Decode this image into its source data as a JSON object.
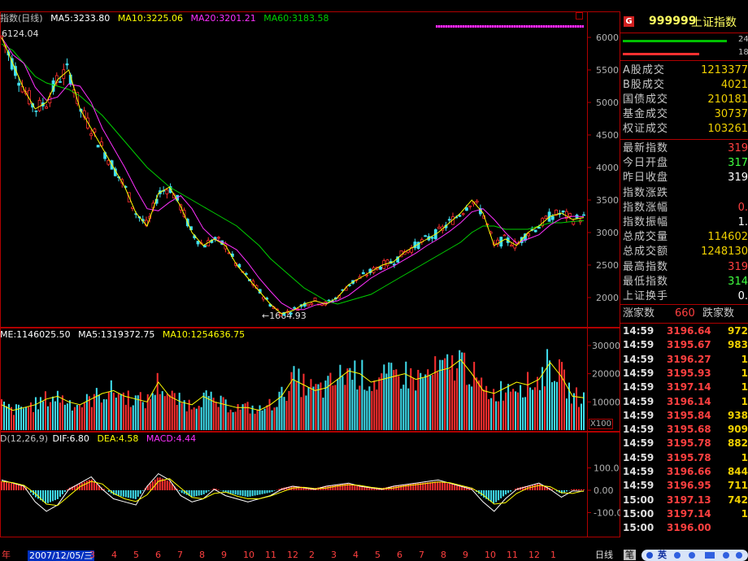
{
  "chart_header": {
    "title_partial": "指数(日线)",
    "ma5": "MA5:3233.80",
    "ma10": "MA10:3225.06",
    "ma20": "MA20:3201.21",
    "ma60": "MA60:3183.58",
    "peak_label": "6124.04",
    "low_label": "←1664.93"
  },
  "volume_header": {
    "vol": "ME:1146025.50",
    "ma5": "MA5:1319372.75",
    "ma10": "MA10:1254636.75",
    "scale": "X100"
  },
  "macd_header": {
    "params": "D(12,26,9)",
    "dif": "DIF:6.80",
    "dea": "DEA:4.58",
    "macd": "MACD:4.44"
  },
  "colors": {
    "up": "#ff3030",
    "down": "#40e0f0",
    "ma5": "#ffffff",
    "ma10": "#ffff00",
    "ma20": "#ff30ff",
    "ma60": "#00d000",
    "frame": "#b00000"
  },
  "chart_data": [
    {
      "type": "line",
      "title": "",
      "ylim": [
        1600,
        6200
      ],
      "yticks": [
        "6000",
        "5500",
        "5000",
        "4500",
        "4000",
        "3500",
        "3000",
        "2500",
        "2000"
      ],
      "series": [
        {
          "name": "MA5",
          "values": [
            6000,
            5600,
            5200,
            4900,
            5000,
            5350,
            5500,
            4900,
            4600,
            4300,
            4000,
            3700,
            3300,
            3100,
            3600,
            3700,
            3400,
            3000,
            2800,
            2900,
            2800,
            2500,
            2300,
            2100,
            1900,
            1750,
            1800,
            1900,
            1950,
            1900,
            2000,
            2200,
            2300,
            2400,
            2500,
            2550,
            2700,
            2800,
            2900,
            3000,
            3150,
            3300,
            3500,
            3300,
            2800,
            2900,
            2800,
            3000,
            3100,
            3250,
            3300,
            3200,
            3230
          ]
        },
        {
          "name": "MA60",
          "values": [
            5900,
            5800,
            5600,
            5400,
            5300,
            5250,
            5200,
            5100,
            4950,
            4800,
            4600,
            4400,
            4200,
            4000,
            3850,
            3700,
            3600,
            3500,
            3400,
            3300,
            3200,
            3100,
            2950,
            2800,
            2600,
            2450,
            2300,
            2150,
            2050,
            1950,
            1900,
            1950,
            2000,
            2050,
            2150,
            2250,
            2350,
            2450,
            2550,
            2650,
            2750,
            2850,
            3000,
            3100,
            3100,
            3050,
            3050,
            3050,
            3100,
            3150,
            3150,
            3170,
            3183
          ]
        }
      ]
    },
    {
      "type": "bar",
      "title": "",
      "ylim": [
        0,
        32000
      ],
      "yticks": [
        "30000",
        "20000",
        "10000"
      ],
      "series": [
        {
          "name": "VOL",
          "values": [
            9000,
            7000,
            8000,
            9000,
            11000,
            12000,
            10000,
            9000,
            11000,
            13000,
            14000,
            12000,
            11000,
            10000,
            17000,
            12000,
            10000,
            9000,
            12000,
            10000,
            9000,
            8000,
            8000,
            7000,
            9000,
            12000,
            18000,
            16000,
            14000,
            15000,
            18000,
            21000,
            20000,
            17000,
            18000,
            19000,
            20000,
            18000,
            19000,
            21000,
            22000,
            25000,
            20000,
            14000,
            13000,
            15000,
            17000,
            16000,
            18000,
            24000,
            19000,
            12000,
            11460
          ]
        }
      ]
    },
    {
      "type": "bar",
      "title": "",
      "ylim": [
        -200,
        200
      ],
      "yticks": [
        "100.0",
        "0.00",
        "-100.0"
      ],
      "series": [
        {
          "name": "MACD",
          "values": [
            40,
            30,
            20,
            -30,
            -60,
            -40,
            10,
            30,
            50,
            10,
            -20,
            -30,
            -40,
            20,
            60,
            40,
            -10,
            -30,
            -20,
            10,
            -10,
            -20,
            -30,
            -20,
            -10,
            10,
            20,
            15,
            10,
            20,
            25,
            30,
            20,
            15,
            10,
            20,
            25,
            30,
            35,
            40,
            30,
            20,
            10,
            -30,
            -60,
            -20,
            10,
            20,
            30,
            10,
            -15,
            5,
            4
          ]
        }
      ]
    }
  ],
  "x_axis": {
    "date_box": "2007/12/05/三",
    "start_label": "年",
    "months": [
      "3",
      "4",
      "5",
      "6",
      "7",
      "8",
      "9",
      "10",
      "11",
      "12",
      "2",
      "3",
      "4",
      "5",
      "6",
      "7",
      "8",
      "9",
      "10",
      "11",
      "12",
      "1"
    ],
    "period": "日线"
  },
  "right_panel": {
    "logo_badge": "G",
    "code": "999999",
    "name": "上证指数",
    "bar_vals": [
      "24",
      "18"
    ],
    "stats": [
      {
        "label": "A股成交",
        "value": "1213377"
      },
      {
        "label": "B股成交",
        "value": "4021"
      },
      {
        "label": "国债成交",
        "value": "210181"
      },
      {
        "label": "基金成交",
        "value": "30737"
      },
      {
        "label": "权证成交",
        "value": "103261"
      }
    ],
    "quotes": [
      {
        "label": "最新指数",
        "value": "319",
        "color": "#ff4040"
      },
      {
        "label": "今日开盘",
        "value": "317",
        "color": "#40ff40"
      },
      {
        "label": "昨日收盘",
        "value": "319",
        "color": "#ffffff"
      },
      {
        "label": "指数涨跌",
        "value": "",
        "color": "#ff4040"
      },
      {
        "label": "指数涨幅",
        "value": "0.",
        "color": "#ff4040"
      },
      {
        "label": "指数振幅",
        "value": "1.",
        "color": "#ffffff"
      },
      {
        "label": "总成交量",
        "value": "114602",
        "color": "#f0d000"
      },
      {
        "label": "总成交额",
        "value": "1248130",
        "color": "#f0d000"
      },
      {
        "label": "最高指数",
        "value": "319",
        "color": "#ff4040"
      },
      {
        "label": "最低指数",
        "value": "314",
        "color": "#40ff40"
      },
      {
        "label": "上证换手",
        "value": "0.",
        "color": "#ffffff"
      }
    ],
    "up_label": "涨家数",
    "up_count": "660",
    "down_label": "跌家数",
    "ticks": [
      {
        "time": "14:59",
        "price": "3196.64",
        "vol": "972"
      },
      {
        "time": "14:59",
        "price": "3195.67",
        "vol": "983"
      },
      {
        "time": "14:59",
        "price": "3196.27",
        "vol": "1"
      },
      {
        "time": "14:59",
        "price": "3195.93",
        "vol": "1"
      },
      {
        "time": "14:59",
        "price": "3197.14",
        "vol": "1"
      },
      {
        "time": "14:59",
        "price": "3196.14",
        "vol": "1"
      },
      {
        "time": "14:59",
        "price": "3195.84",
        "vol": "938"
      },
      {
        "time": "14:59",
        "price": "3195.68",
        "vol": "909"
      },
      {
        "time": "14:59",
        "price": "3195.78",
        "vol": "882"
      },
      {
        "time": "14:59",
        "price": "3195.78",
        "vol": "1"
      },
      {
        "time": "14:59",
        "price": "3196.66",
        "vol": "844"
      },
      {
        "time": "14:59",
        "price": "3196.95",
        "vol": "711"
      },
      {
        "time": "15:00",
        "price": "3197.13",
        "vol": "742"
      },
      {
        "time": "15:00",
        "price": "3197.14",
        "vol": "1"
      },
      {
        "time": "15:00",
        "price": "3196.00",
        "vol": ""
      }
    ],
    "bottom_tabs": [
      "笔",
      "英"
    ]
  }
}
